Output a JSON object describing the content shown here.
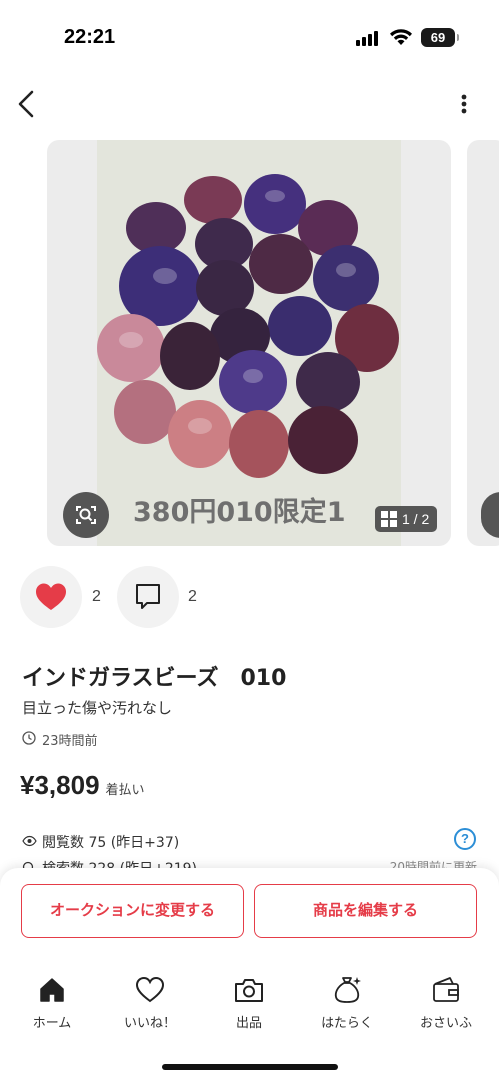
{
  "status_bar": {
    "time": "22:21",
    "battery": "69"
  },
  "nav": {
    "back_icon": "chevron-left-icon",
    "menu_icon": "more-vertical-icon"
  },
  "carousel": {
    "watermark": "380円010限定1",
    "page_indicator": "1 / 2",
    "colors": {
      "background": "#e3e5dc",
      "bead_purple": "#4a2f7a",
      "bead_amber": "#6e2e40",
      "bead_pink": "#c9899a"
    }
  },
  "actions": {
    "like_count": "2",
    "comment_count": "2",
    "like_color": "#e53c48"
  },
  "item": {
    "title": "インドガラスビーズ　010",
    "condition": "目立った傷や汚れなし",
    "posted": "23時間前",
    "price": "¥3,809",
    "shipping": "着払い",
    "views": "閲覧数  75 (昨日+37)",
    "searches": "検索数  228 (昨日+219)",
    "updated": "20時間前に更新"
  },
  "buttons": {
    "auction": "オークションに変更する",
    "edit": "商品を編集する",
    "accent": "#e53c48"
  },
  "tabs": [
    {
      "label": "ホーム",
      "icon": "home-icon"
    },
    {
      "label": "いいね！",
      "icon": "heart-icon"
    },
    {
      "label": "出品",
      "icon": "camera-icon"
    },
    {
      "label": "はたらく",
      "icon": "money-bag-icon"
    },
    {
      "label": "おさいふ",
      "icon": "wallet-icon"
    }
  ]
}
